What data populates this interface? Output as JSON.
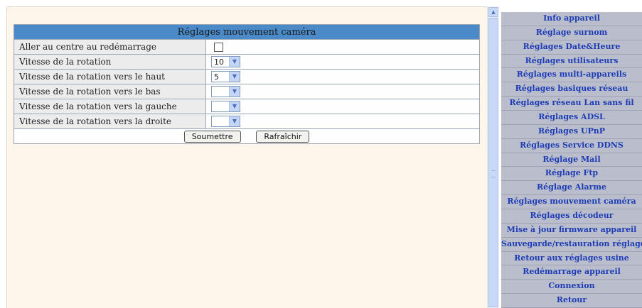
{
  "panel": {
    "title": "Réglages mouvement caméra",
    "rows": [
      {
        "label": "Aller au centre au redémarrage",
        "control": "checkbox",
        "checked": false
      },
      {
        "label": "Vitesse de la rotation",
        "control": "select",
        "value": "10"
      },
      {
        "label": "Vitesse de la rotation vers le haut",
        "control": "select",
        "value": "5"
      },
      {
        "label": "Vitesse de la rotation vers le bas",
        "control": "select",
        "value": ""
      },
      {
        "label": "Vitesse de la rotation vers la gauche",
        "control": "select",
        "value": ""
      },
      {
        "label": "Vitesse de la rotation vers la droite",
        "control": "select",
        "value": ""
      }
    ],
    "submit_label": "Soumettre",
    "refresh_label": "Rafraîchir"
  },
  "sidebar": {
    "items": [
      "Info appareil",
      "Réglage surnom",
      "Réglages Date&Heure",
      "Réglages utilisateurs",
      "Réglages multi-appareils",
      "Réglages basiques réseau",
      "Réglages réseau Lan sans fil",
      "Réglages ADSL",
      "Réglages UPnP",
      "Réglages Service DDNS",
      "Réglage Mail",
      "Réglage Ftp",
      "Réglage Alarme",
      "Réglages mouvement caméra",
      "Réglages décodeur",
      "Mise à jour firmware appareil",
      "Sauvegarde/restauration réglages",
      "Retour aux réglages usine",
      "Redémarrage appareil",
      "Connexion",
      "Retour"
    ]
  },
  "colors": {
    "header_bg": "#4a8ac8",
    "page_bg": "#fef6ea",
    "sidebar_bg": "#b9bdcc",
    "sidebar_text": "#1e3cb4"
  },
  "icons": {
    "select_arrow": "chevron-down-icon",
    "scroll_up": "chevron-up-icon"
  }
}
